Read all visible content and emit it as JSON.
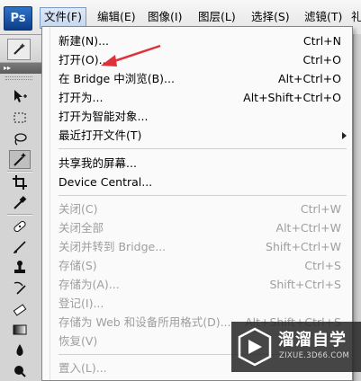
{
  "app": {
    "logo": "Ps"
  },
  "menubar": {
    "items": [
      {
        "label": "文件(F)",
        "active": true
      },
      {
        "label": "编辑(E)"
      },
      {
        "label": "图像(I)"
      },
      {
        "label": "图层(L)"
      },
      {
        "label": "选择(S)"
      },
      {
        "label": "滤镜(T)"
      },
      {
        "label": "礼"
      }
    ]
  },
  "toolpanel": {
    "header": "▸▸"
  },
  "file_menu": {
    "items": [
      {
        "label": "新建(N)...",
        "shortcut": "Ctrl+N"
      },
      {
        "label": "打开(O)...",
        "shortcut": "Ctrl+O"
      },
      {
        "label": "在 Bridge 中浏览(B)...",
        "shortcut": "Alt+Ctrl+O"
      },
      {
        "label": "打开为...",
        "shortcut": "Alt+Shift+Ctrl+O"
      },
      {
        "label": "打开为智能对象..."
      },
      {
        "label": "最近打开文件(T)",
        "submenu": true
      },
      {
        "label": "共享我的屏幕..."
      },
      {
        "label": "Device Central..."
      },
      {
        "label": "关闭(C)",
        "shortcut": "Ctrl+W",
        "disabled": true
      },
      {
        "label": "关闭全部",
        "shortcut": "Alt+Ctrl+W",
        "disabled": true
      },
      {
        "label": "关闭并转到 Bridge...",
        "shortcut": "Shift+Ctrl+W",
        "disabled": true
      },
      {
        "label": "存储(S)",
        "shortcut": "Ctrl+S",
        "disabled": true
      },
      {
        "label": "存储为(A)...",
        "shortcut": "Shift+Ctrl+S",
        "disabled": true
      },
      {
        "label": "登记(I)...",
        "disabled": true
      },
      {
        "label": "存储为 Web 和设备所用格式(D)...",
        "shortcut": "Alt+Shift+Ctrl+S",
        "disabled": true
      },
      {
        "label": "恢复(V)",
        "disabled": true
      },
      {
        "label": "置入(L)...",
        "disabled": true
      }
    ]
  },
  "watermark": {
    "title": "溜溜自学",
    "url": "ZIXUE.3D66.COM"
  },
  "colors": {
    "annotation_arrow": "#e0303a",
    "active_menu": "#c6d6ef",
    "disabled_text": "#9e9e9e"
  },
  "icons": [
    "move-icon",
    "marquee-icon",
    "lasso-icon",
    "magic-wand-icon",
    "crop-icon",
    "eyedropper-icon",
    "healing-brush-icon",
    "brush-icon",
    "clone-stamp-icon",
    "history-brush-icon",
    "eraser-icon",
    "gradient-icon",
    "blur-icon",
    "dodge-icon"
  ]
}
